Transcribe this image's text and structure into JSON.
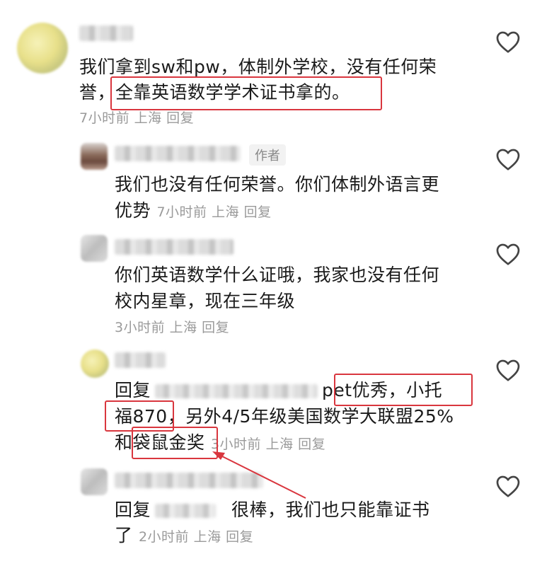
{
  "comments": [
    {
      "text_line1": "我们拿到sw和pw，体制外学校，没有任何荣",
      "text_line2": "誉，全靠英语数学学术证书拿的。",
      "meta": "7小时前 上海 回复"
    },
    {
      "author_tag": "作者",
      "text_line1": "我们也没有任何荣誉。你们体制外语言更",
      "text_line2": "优势",
      "meta": "7小时前 上海 回复"
    },
    {
      "text_line1": "你们英语数学什么证哦，我家也没有任何",
      "text_line2": "校内星章，现在三年级",
      "meta": "3小时前 上海 回复"
    },
    {
      "reply_prefix": "回复",
      "text_line1_tail": "pet优秀，小托",
      "text_line2": "福870，另外4/5年级美国数学大联盟25%",
      "text_line3_head": "和袋鼠金奖",
      "meta": "3小时前 上海 回复"
    },
    {
      "reply_prefix": "回复",
      "text_line1_tail": "很棒，我们也只能靠证书",
      "text_line2_head": "了",
      "meta": "2小时前 上海 回复"
    }
  ],
  "colors": {
    "highlight": "#d9363e",
    "meta": "#9a9a9a",
    "heart": "#444444"
  }
}
